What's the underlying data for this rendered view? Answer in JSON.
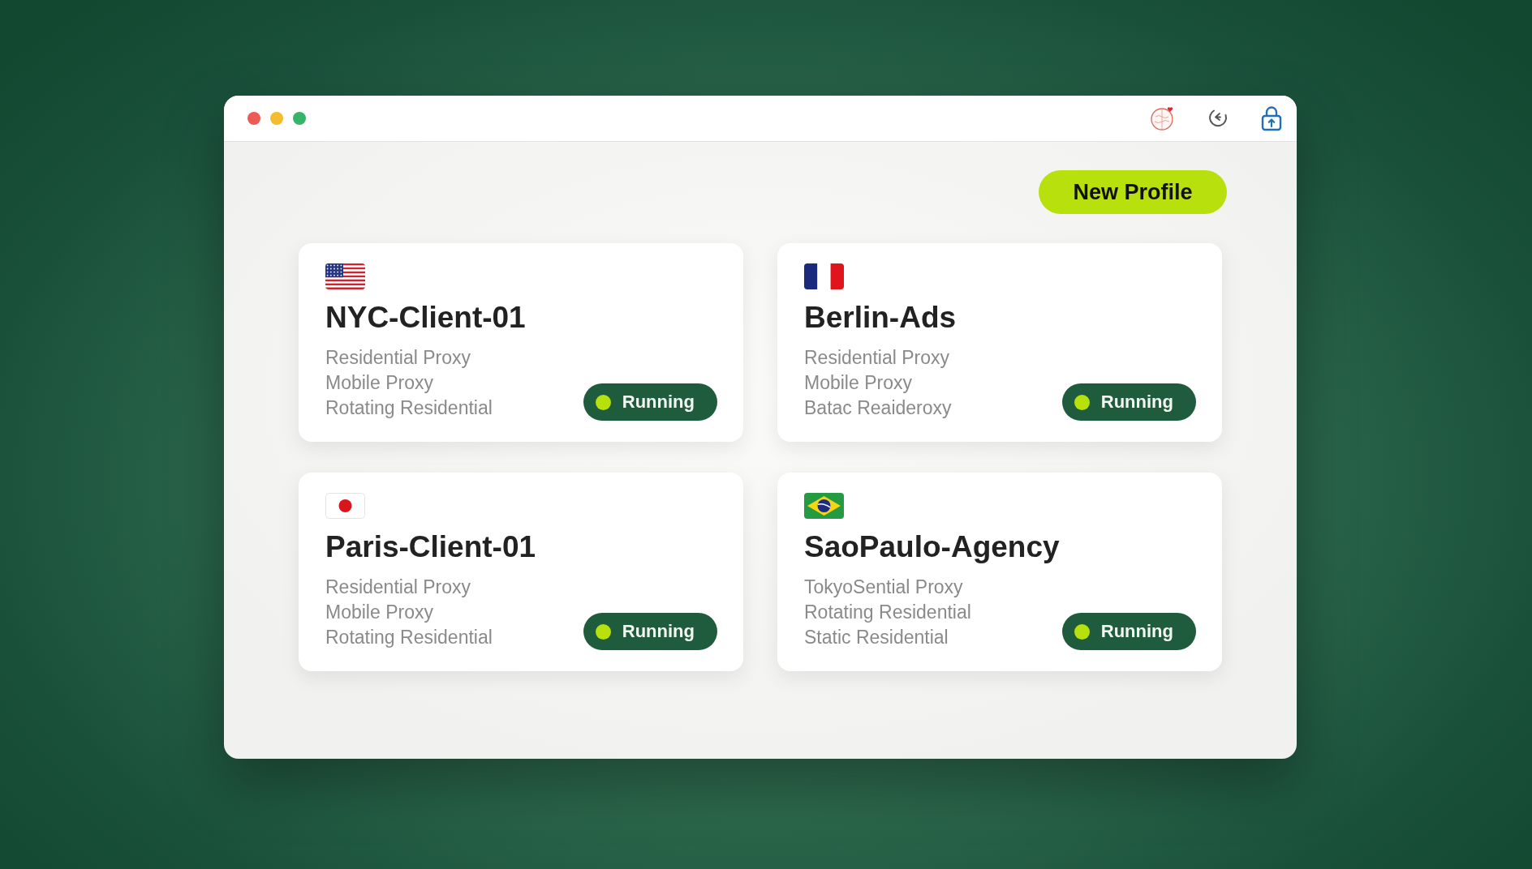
{
  "toolbar": {
    "new_profile_button": "New Profile"
  },
  "profiles": [
    {
      "kind": "us",
      "name": "NYC-Client-01",
      "proxies": [
        "Residential Proxy",
        "Mobile Proxy",
        "Rotating Residential"
      ],
      "status": "Running"
    },
    {
      "kind": "fr",
      "name": "Berlin-Ads",
      "proxies": [
        "Residential Proxy",
        "Mobile Proxy",
        "Batac Reaideroxy"
      ],
      "status": "Running"
    },
    {
      "kind": "jp",
      "name": "Paris-Client-01",
      "proxies": [
        "Residential Proxy",
        "Mobile Proxy",
        "Rotating Residential"
      ],
      "status": "Running"
    },
    {
      "kind": "br",
      "name": "SaoPaulo-Agency",
      "proxies": [
        "TokyoSential Proxy",
        "Rotating Residential",
        "Static Residential"
      ],
      "status": "Running"
    }
  ]
}
